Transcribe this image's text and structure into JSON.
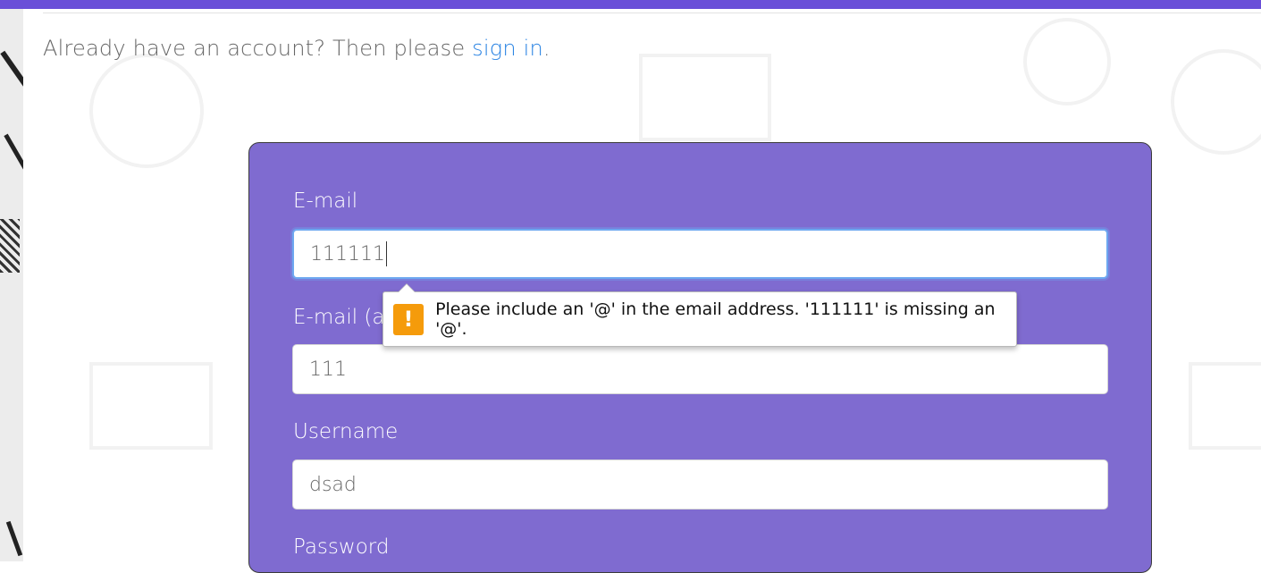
{
  "header": {
    "text": "Already have an account? Then please ",
    "link": "sign in",
    "suffix": "."
  },
  "form": {
    "email": {
      "label": "E-mail",
      "value": "111111"
    },
    "email_again": {
      "label": "E-mail (a",
      "value": "111"
    },
    "username": {
      "label": "Username",
      "value": "dsad"
    },
    "password": {
      "label": "Password"
    }
  },
  "validation": {
    "icon": "warning-icon",
    "symbol": "!",
    "message": "Please include an '@' in the email address. '111111' is missing an '@'."
  },
  "colors": {
    "accent": "#6a4fd8",
    "card": "#7f6bd0",
    "link": "#2b84e3",
    "warning": "#f59b0b"
  }
}
